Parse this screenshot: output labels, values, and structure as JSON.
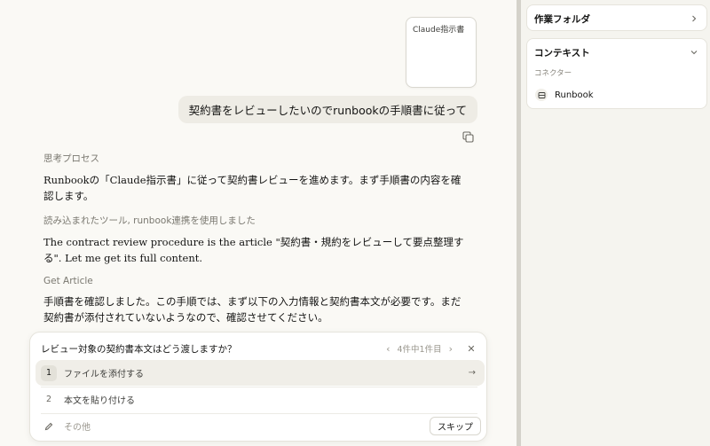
{
  "attachment": {
    "title": "Claude指示書"
  },
  "user_message": {
    "text": "契約書をレビューしたいのでrunbookの手順書に従って"
  },
  "messages": [
    {
      "label": "思考プロセス",
      "text": "Runbookの「Claude指示書」に従って契約書レビューを進めます。まず手順書の内容を確認します。"
    },
    {
      "label": "読み込まれたツール, runbook連携を使用しました",
      "text": "The contract review procedure is the article \"契約書・規約をレビューして要点整理する\". Let me get its full content."
    },
    {
      "label": "Get Article",
      "text": "手順書を確認しました。この手順では、まず以下の入力情報と契約書本文が必要です。まだ契約書が添付されていないようなので、確認させてください。"
    }
  ],
  "question": {
    "title": "レビュー対象の契約書本文はどう渡しますか？",
    "pager": "4件中1件目",
    "options": [
      {
        "num": "1",
        "label": "ファイルを添付する"
      },
      {
        "num": "2",
        "label": "本文を貼り付ける"
      }
    ],
    "other_placeholder": "その他",
    "skip_label": "スキップ"
  },
  "sidebar": {
    "folder_title": "作業フォルダ",
    "context_title": "コンテキスト",
    "connectors_label": "コネクター",
    "connectors": [
      {
        "label": "Runbook"
      }
    ]
  },
  "icons": {
    "copy": "copy-icon",
    "chevron_left": "chevron-left-icon",
    "chevron_right": "chevron-right-icon",
    "chevron_down": "chevron-down-icon",
    "close": "close-icon",
    "arrow_right": "arrow-right-icon",
    "pencil": "pencil-icon",
    "runbook": "runbook-icon"
  }
}
